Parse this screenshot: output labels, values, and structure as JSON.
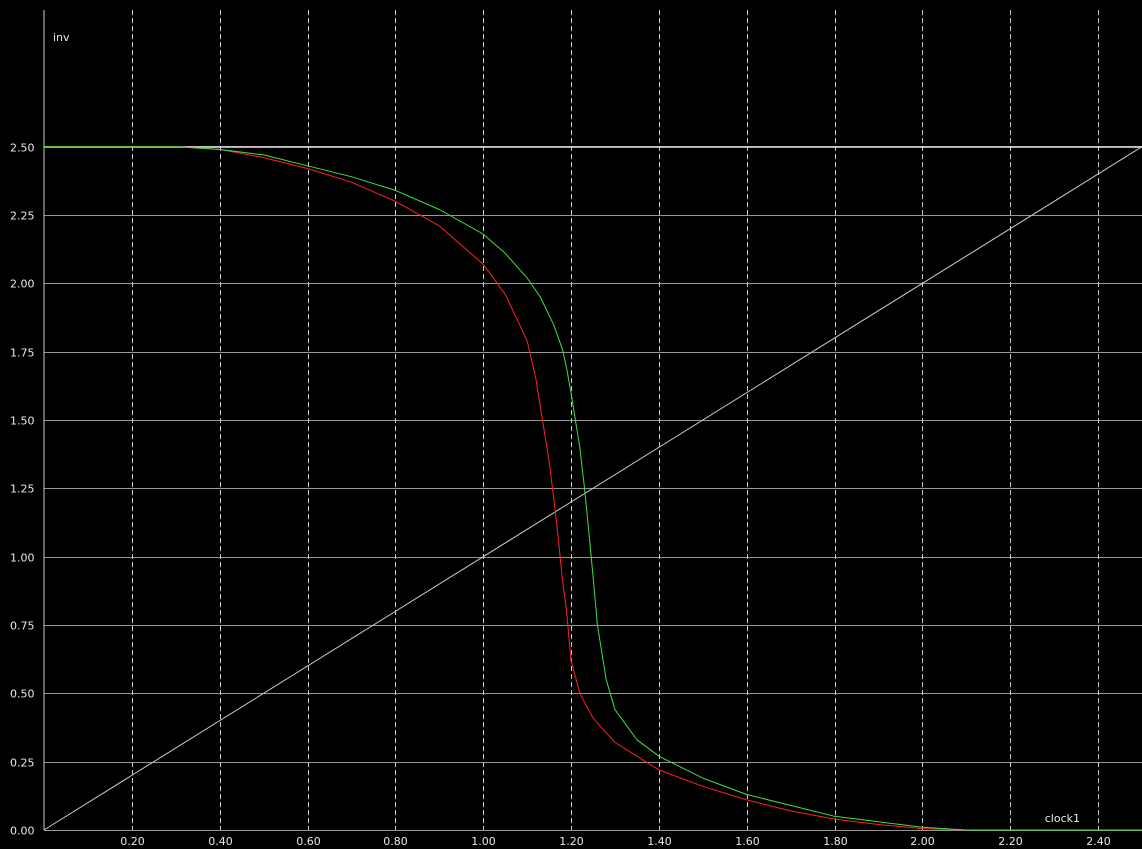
{
  "chart_data": {
    "type": "line",
    "ylabel": "inv",
    "xlabel": "clock1",
    "xlim": [
      0.0,
      2.5
    ],
    "ylim": [
      0.0,
      3.0
    ],
    "x_ticks": [
      "0.20",
      "0.40",
      "0.60",
      "0.80",
      "1.00",
      "1.20",
      "1.40",
      "1.60",
      "1.80",
      "2.00",
      "2.20",
      "2.40"
    ],
    "x_tick_values": [
      0.2,
      0.4,
      0.6,
      0.8,
      1.0,
      1.2,
      1.4,
      1.6,
      1.8,
      2.0,
      2.2,
      2.4
    ],
    "y_ticks": [
      "0.00",
      "0.25",
      "0.50",
      "0.75",
      "1.00",
      "1.25",
      "1.50",
      "1.75",
      "2.00",
      "2.25",
      "2.50"
    ],
    "y_tick_values": [
      0.0,
      0.25,
      0.5,
      0.75,
      1.0,
      1.25,
      1.5,
      1.75,
      2.0,
      2.25,
      2.5
    ],
    "grid": true,
    "colors": {
      "background": "#000000",
      "grid": "#c8c8c8",
      "text": "#e8e8e8"
    },
    "series": [
      {
        "color": "#cccccc",
        "x": [
          0.0,
          2.5
        ],
        "y": [
          0.0,
          2.5
        ]
      },
      {
        "color": "#ffffff",
        "x": [
          0.0,
          2.5
        ],
        "y": [
          2.5,
          2.5
        ]
      },
      {
        "color": "#ff2020",
        "x": [
          0.0,
          0.3,
          0.4,
          0.5,
          0.6,
          0.7,
          0.8,
          0.9,
          1.0,
          1.05,
          1.1,
          1.12,
          1.14,
          1.15,
          1.16,
          1.17,
          1.18,
          1.19,
          1.2,
          1.22,
          1.25,
          1.3,
          1.35,
          1.4,
          1.5,
          1.6,
          1.7,
          1.8,
          1.9,
          2.0,
          2.1,
          2.2,
          2.5
        ],
        "y": [
          2.5,
          2.5,
          2.49,
          2.46,
          2.42,
          2.37,
          2.3,
          2.21,
          2.07,
          1.96,
          1.79,
          1.65,
          1.45,
          1.35,
          1.22,
          1.08,
          0.92,
          0.8,
          0.62,
          0.5,
          0.41,
          0.32,
          0.27,
          0.22,
          0.16,
          0.11,
          0.07,
          0.04,
          0.02,
          0.005,
          0.0,
          0.0,
          0.0
        ]
      },
      {
        "color": "#40e040",
        "x": [
          0.0,
          0.3,
          0.4,
          0.5,
          0.6,
          0.7,
          0.8,
          0.9,
          1.0,
          1.05,
          1.1,
          1.13,
          1.16,
          1.18,
          1.19,
          1.2,
          1.21,
          1.22,
          1.23,
          1.24,
          1.25,
          1.26,
          1.28,
          1.3,
          1.35,
          1.4,
          1.5,
          1.6,
          1.7,
          1.8,
          1.9,
          2.0,
          2.1,
          2.2,
          2.5
        ],
        "y": [
          2.5,
          2.5,
          2.49,
          2.47,
          2.43,
          2.39,
          2.34,
          2.27,
          2.18,
          2.11,
          2.02,
          1.95,
          1.85,
          1.76,
          1.69,
          1.6,
          1.5,
          1.4,
          1.26,
          1.1,
          0.93,
          0.75,
          0.55,
          0.44,
          0.33,
          0.27,
          0.19,
          0.13,
          0.09,
          0.05,
          0.03,
          0.01,
          0.0,
          0.0,
          0.0
        ]
      }
    ]
  }
}
